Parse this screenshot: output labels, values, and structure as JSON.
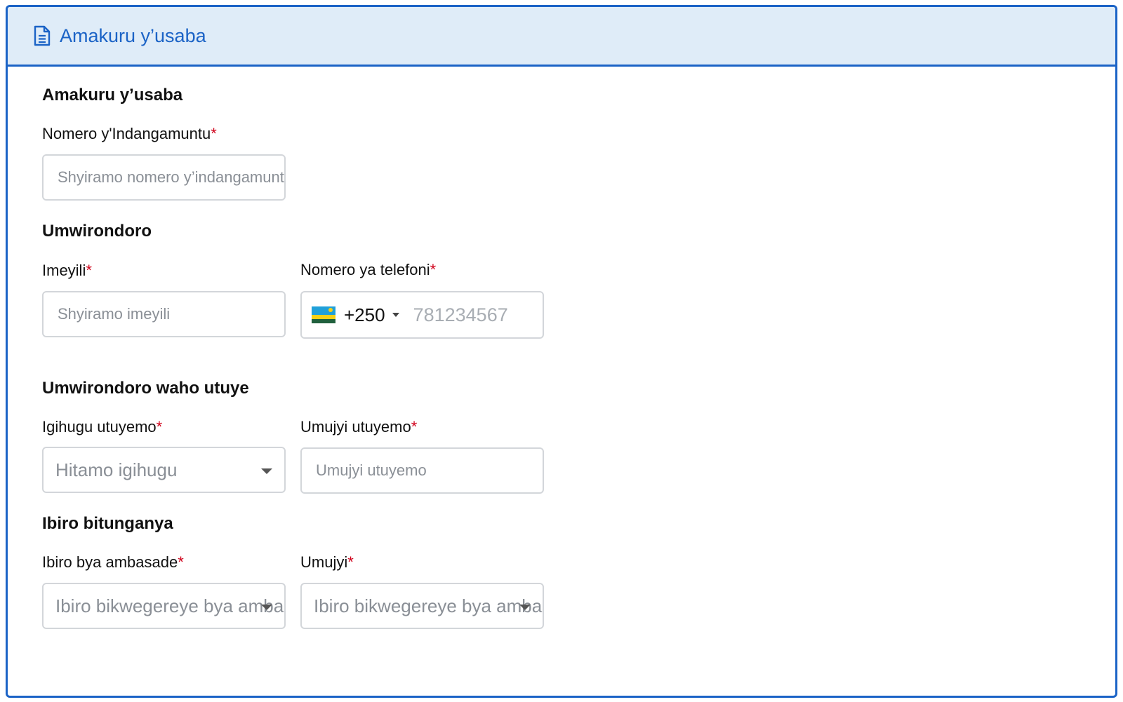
{
  "header": {
    "title": "Amakuru y’usaba",
    "icon": "document-icon"
  },
  "sections": {
    "applicant": {
      "title": "Amakuru y’usaba",
      "national_id": {
        "label": "Nomero y'Indangamuntu",
        "required": "*",
        "placeholder": "Shyiramo nomero y’indangamuntu"
      }
    },
    "contact": {
      "title": "Umwirondoro",
      "email": {
        "label": "Imeyili",
        "required": "*",
        "placeholder": "Shyiramo imeyili"
      },
      "phone": {
        "label": "Nomero ya telefoni",
        "required": "*",
        "country_code": "+250",
        "flag": "rwanda-flag-icon",
        "placeholder": "781234567"
      }
    },
    "residence": {
      "title": "Umwirondoro waho utuye",
      "country": {
        "label": "Igihugu utuyemo",
        "required": "*",
        "placeholder": "Hitamo igihugu"
      },
      "city": {
        "label": "Umujyi utuyemo",
        "required": "*",
        "placeholder": "Umujyi utuyemo"
      }
    },
    "processing": {
      "title": "Ibiro bitunganya",
      "embassy": {
        "label": "Ibiro bya ambasade",
        "required": "*",
        "placeholder": "Ibiro bikwegereye bya ambasade"
      },
      "city": {
        "label": "Umujyi",
        "required": "*",
        "placeholder": "Ibiro bikwegereye bya ambasade"
      }
    }
  },
  "colors": {
    "accent": "#1b63c6",
    "header_bg": "#dfecf8",
    "required": "#d0021b",
    "border": "#d3d6da"
  }
}
